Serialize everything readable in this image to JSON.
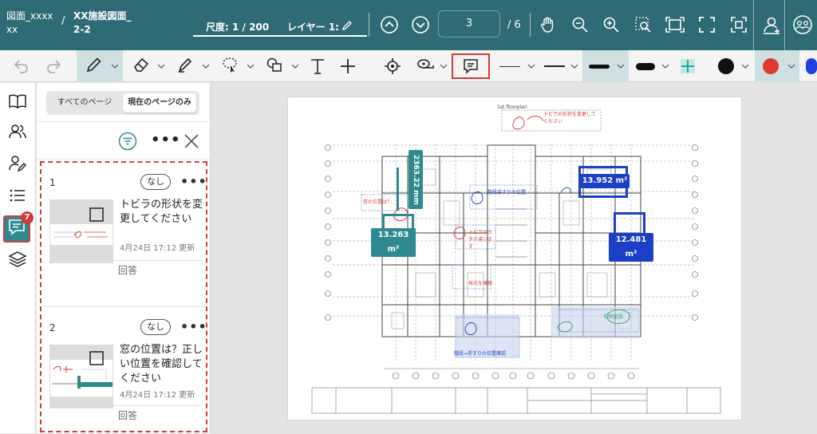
{
  "header": {
    "breadcrumb_1": "図面_xxxx xx",
    "breadcrumb_sep": "/",
    "breadcrumb_2": "XX施設図面_ 2-2",
    "scale_label": "尺度: 1 / 200",
    "layer_label": "レイヤー 1:",
    "page_current": "3",
    "page_total": "/ 6"
  },
  "toolbar": {
    "tools": [
      "undo-icon",
      "redo-icon",
      "pencil-icon",
      "eraser-icon",
      "highlighter-icon",
      "lasso-select-icon",
      "shapes-icon",
      "text-icon",
      "plus-icon",
      "target-icon",
      "measure-tape-icon",
      "comment-icon"
    ],
    "colors": {
      "accent": "#2f6b74",
      "highlight_red": "#d23b3b",
      "swatch_black": "#111111",
      "swatch_red": "#e03a2f",
      "swatch_blue": "#1f3fe0"
    }
  },
  "sidebar": {
    "comment_badge": "7"
  },
  "panel": {
    "tab_all": "すべてのページ",
    "tab_current": "現在のページのみ",
    "comments": [
      {
        "num": "1",
        "status": "なし",
        "title": "トビラの形状を変更してください",
        "date": "4月24日 17:12 更新",
        "reply": "回答"
      },
      {
        "num": "2",
        "status": "なし",
        "title": "窓の位置は？正しい位置を確認してください",
        "date": "4月24日 17:12 更新",
        "reply": "回答"
      }
    ]
  },
  "drawing": {
    "plan_title": "1st floorplan",
    "measurements": [
      "13.952 m²",
      "13.263 m²",
      "12.481 m²",
      "2363.22 mm"
    ],
    "notes": [
      "トビラの形状を変更してください",
      "窓の位置は？",
      "階段手すりの位置",
      "トビラのカタチ違います",
      "採光を確保",
      "照明追加",
      "階段→手すりの位置確認"
    ]
  }
}
